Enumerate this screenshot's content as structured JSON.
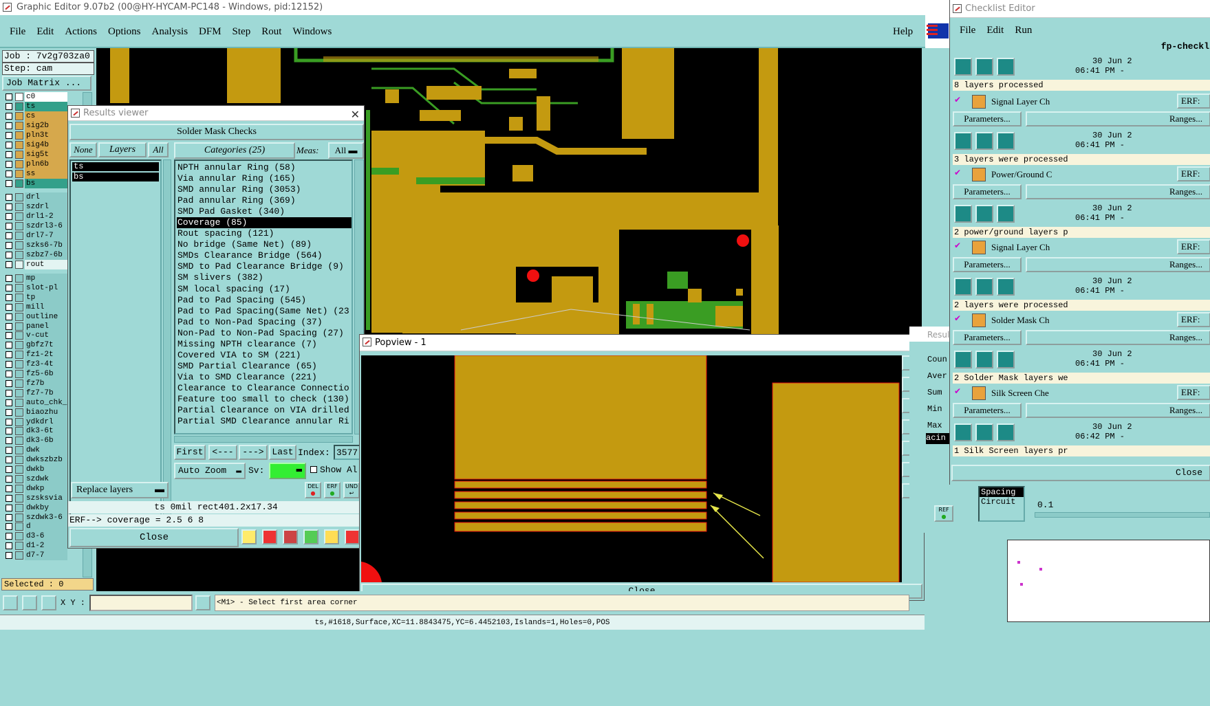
{
  "main_window": {
    "title": "Graphic Editor 9.07b2 (00@HY-HYCAM-PC148 - Windows, pid:12152)",
    "menu": [
      "File",
      "Edit",
      "Actions",
      "Options",
      "Analysis",
      "DFM",
      "Step",
      "Rout",
      "Windows"
    ],
    "help": "Help",
    "job_label": "Job : 7v2g703za0",
    "step_label": "Step: cam",
    "job_matrix_button": "Job Matrix ...",
    "layers": [
      {
        "name": "c0",
        "color": "#ffffff"
      },
      {
        "name": "ts",
        "color": "#33a08a"
      },
      {
        "name": "cs",
        "color": "#d6a84c"
      },
      {
        "name": "sig2b",
        "color": "#d6a84c"
      },
      {
        "name": "pln3t",
        "color": "#d6a84c"
      },
      {
        "name": "sig4b",
        "color": "#d6a84c"
      },
      {
        "name": "sig5t",
        "color": "#d6a84c"
      },
      {
        "name": "pln6b",
        "color": "#d6a84c"
      },
      {
        "name": "ss",
        "color": "#d6a84c"
      },
      {
        "name": "bs",
        "color": "#33a08a"
      }
    ],
    "drill_layers": [
      "drl",
      "szdrl",
      "drl1-2",
      "szdrl3-6",
      "drl7-7",
      "szks6-7b",
      "szbz7-6b",
      "rout"
    ],
    "misc_layers": [
      "mp",
      "slot-pl",
      "tp",
      "mill",
      "outline",
      "panel",
      "v-cut",
      "gbfz7t",
      "fz1-2t",
      "fz3-4t",
      "fz5-6b",
      "fz7b",
      "fz7-7b",
      "auto_chk_r",
      "biaozhu",
      "ydkdrl",
      "dk3-6t",
      "dk3-6b",
      "dwk",
      "dwkszbzb",
      "dwkb",
      "szdwk",
      "dwkp",
      "szsksvia",
      "dwkby",
      "szdwk3-6",
      "d",
      "d3-6",
      "d1-2",
      "d7-7"
    ],
    "selected": "Selected : 0",
    "xy_label": "X Y :",
    "prompt": "<M1> - Select first area corner",
    "status": "ts,#1618,Surface,XC=11.8843475,YC=6.4452103,Islands=1,Holes=0,POS"
  },
  "results_viewer": {
    "title": "Results viewer",
    "header": "Solder Mask Checks",
    "none": "None",
    "layers": "Layers",
    "all": "All",
    "categories": "Categories (25)",
    "meas": "Meas:",
    "meas_value": "All",
    "layer_list": [
      "ts",
      "bs"
    ],
    "items": [
      "NPTH annular Ring (58)",
      "Via annular Ring (165)",
      "SMD annular Ring (3053)",
      "Pad annular Ring (369)",
      "SMD Pad Gasket (340)",
      "Coverage (85)",
      "Rout spacing (121)",
      "No bridge (Same Net) (89)",
      "SMDs Clearance Bridge (564)",
      "SMD to Pad Clearance Bridge (9)",
      "SM slivers (382)",
      "SM local spacing (17)",
      "Pad to Pad Spacing (545)",
      "Pad to Pad Spacing(Same Net) (23",
      "Pad to Non-Pad Spacing (37)",
      "Non-Pad to Non-Pad Spacing (27)",
      "Missing NPTH clearance (7)",
      "Covered VIA to SM (221)",
      "SMD Partial Clearance (65)",
      "Via to SMD Clearance (221)",
      "Clearance to Clearance Connectio",
      "Feature too small to check (130)",
      "Partial Clearance on VIA drilled",
      "Partial SMD Clearance annular Ri"
    ],
    "selected_index": 5,
    "first": "First",
    "prev": "<---",
    "next": "--->",
    "last": "Last",
    "index_label": "Index:",
    "index_value": "3577",
    "auto_zoom": "Auto Zoom",
    "sv": "Sv:",
    "show_all": "Show Al",
    "replace_layers": "Replace layers",
    "del": "DEL",
    "erf": "ERF",
    "und": "UND",
    "info_line": "ts 0mil  rect401.2x17.34",
    "erf_line": "ERF--> coverage = 2.5 6 8",
    "close": "Close"
  },
  "popview": {
    "title": "Popview - 1",
    "close": "Close"
  },
  "checklist_editor": {
    "title": "Checklist Editor",
    "menu": [
      "File",
      "Edit",
      "Run"
    ],
    "checklist_name": "fp-checkl",
    "entries": [
      {
        "date": "30 Jun 2",
        "time": "06:41 PM - ",
        "message": "8 layers processed"
      },
      {
        "name": "Signal Layer Ch",
        "erf": "ERF:",
        "params": "Parameters...",
        "ranges": "Ranges...",
        "date": "30 Jun 2",
        "time": "06:41 PM - ",
        "message": "3 layers were processed"
      },
      {
        "name": "Power/Ground C",
        "erf": "ERF:",
        "params": "Parameters...",
        "ranges": "Ranges...",
        "date": "30 Jun 2",
        "time": "06:41 PM - ",
        "message": "2 power/ground layers p"
      },
      {
        "name": "Signal Layer Ch",
        "erf": "ERF:",
        "params": "Parameters...",
        "ranges": "Ranges...",
        "date": "30 Jun 2",
        "time": "06:41 PM - ",
        "message": "2 layers were processed"
      },
      {
        "name": "Solder Mask Ch",
        "erf": "ERF:",
        "params": "Parameters...",
        "ranges": "Ranges...",
        "date": "30 Jun 2",
        "time": "06:41 PM - ",
        "message": "2 Solder Mask layers we"
      },
      {
        "name": "Silk Screen Che",
        "erf": "ERF:",
        "params": "Parameters...",
        "ranges": "Ranges...",
        "date": "30 Jun 2",
        "time": "06:42 PM - ",
        "message": "1 Silk Screen layers pr"
      }
    ],
    "close": "Close"
  },
  "result_stats": {
    "title": "Result",
    "labels": [
      "Coun",
      "Aver",
      "Sum",
      "Min",
      "Max"
    ],
    "spacing_tab": "acin",
    "spacing": "Spacing",
    "circuit": "Circuit",
    "value": "0.1",
    "ref": "REF"
  }
}
